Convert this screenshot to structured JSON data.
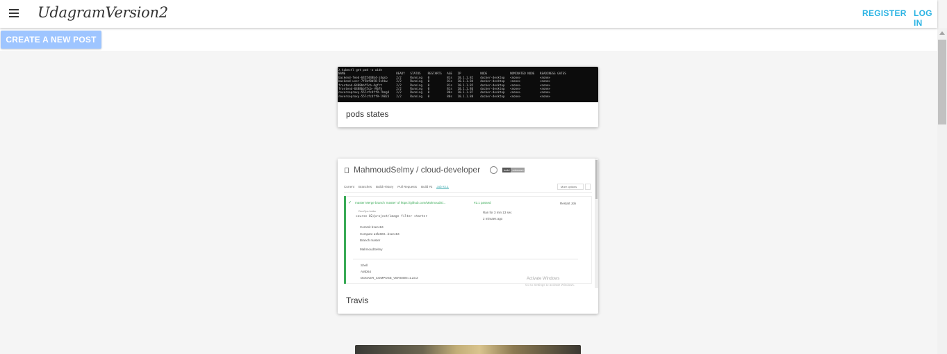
{
  "app": {
    "brand": "UdagramVersion2"
  },
  "nav": {
    "register": "REGISTER",
    "login": "LOG IN"
  },
  "actions": {
    "create_post": "CREATE A NEW POST"
  },
  "feed": {
    "posts": [
      {
        "caption": "pods states",
        "terminal_lines": [
          "λ kubectl get pod -o wide",
          "NAME                             READY   STATUS    RESTARTS   AGE   IP           NODE             NOMINATED NODE   READINESS GATES",
          "backend-feed-6455448b4-z4gsb     2/2     Running   0          81s   10.1.1.82    docker-desktop   <none>           <none>",
          "backend-user-7f5bf8d58-5vhkw     2/2     Running   0          81s   10.1.1.84    docker-desktop   <none>           <none>",
          "frontend-6488bbf5cb-4gfrt        2/2     Running   0          81s   10.1.1.85    docker-desktop   <none>           <none>",
          "frontend-6488bbf5cb-r9b7h        2/2     Running   0          81s   10.1.1.86    docker-desktop   <none>           <none>",
          "reverseproxy-557cfc4ff9-7hmg4    2/2     Running   0          80s   10.1.1.87    docker-desktop   <none>           <none>",
          "reverseproxy-557cfc4ff9-l9823    2/2     Running   0          80s   10.1.1.88    docker-desktop   <none>           <none>"
        ]
      },
      {
        "caption": "Travis",
        "screenshot": {
          "repo": "MahmoudSelmy / cloud-developer",
          "badge_left": "build",
          "badge_right": "unknown",
          "tabs": [
            "Current",
            "Branches",
            "Build History",
            "Pull Requests",
            "Build #2",
            "Job #2.1"
          ],
          "more_options": "More options",
          "branch_line": "master  Merge branch 'master' of https://github.com/MahmoudS/...",
          "job_passed": "#2.1 passed",
          "restart": "Restart Job",
          "ran_for": "Ran for 3 min 13 sec",
          "ago": "2 minutes ago",
          "env_label": "DevOps folder",
          "env_path": "course 02/project/image filter starter",
          "commit": "Commit b1ecc84",
          "compare": "Compare a1fe603...b1ecc84",
          "branch": "Branch master",
          "author": "MahmoudSelmy",
          "shell": "Shell",
          "arch": "AMD64",
          "env_var": "DOCKER_COMPOSE_VERSION=1.23.2",
          "watermark_title": "Activate Windows",
          "watermark_sub": "Go to Settings to activate Windows."
        }
      },
      {
        "caption": ""
      }
    ]
  }
}
